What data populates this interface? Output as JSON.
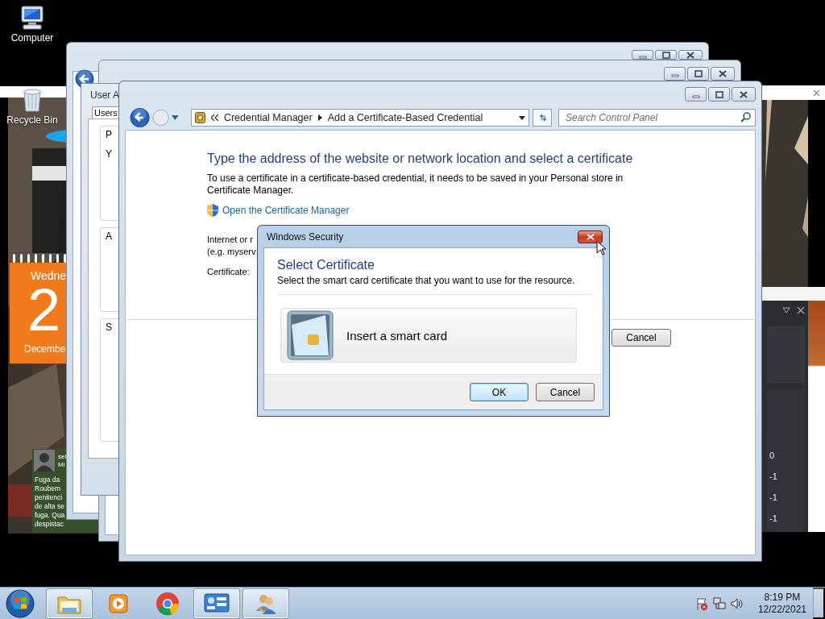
{
  "desktop_icons": [
    {
      "kind": "computer",
      "label": "Computer"
    },
    {
      "kind": "recycle_bin",
      "label": "Recycle Bin"
    }
  ],
  "calendar_gadget": {
    "weekday": "Wedne",
    "day": "2",
    "month": "Decembe"
  },
  "news_gadget": {
    "author": "sel",
    "subtitle": "Mi",
    "lines": [
      "Fuga da",
      "Roubem",
      "penitenci",
      "de alta se",
      "fuga. Qua",
      "despistac"
    ]
  },
  "side_app": {
    "values": [
      "0",
      "-1",
      "-1",
      "-1"
    ]
  },
  "user_accounts_window": {
    "title": "User A",
    "tab": "Users",
    "groups": [
      "P",
      "A",
      "S"
    ],
    "line": "Y"
  },
  "main_window": {
    "breadcrumb": [
      "Credential Manager",
      "Add a Certificate-Based Credential"
    ],
    "search": {
      "placeholder": "Search Control Panel"
    },
    "heading": "Type the address of the website or network location and select a certificate",
    "description": "To use a certificate in a certificate-based credential, it needs to be saved in your Personal store in Certificate Manager.",
    "link": "Open the Certificate Manager",
    "fields": [
      {
        "label": "Internet or r",
        "example": "(e.g. myserv"
      },
      {
        "label": "Certificate:"
      }
    ],
    "buttons": [
      "Cancel"
    ]
  },
  "dialog": {
    "title": "Windows Security",
    "heading": "Select Certificate",
    "description": "Select the smart card certificate that you want to use for the resource.",
    "option": "Insert a smart card",
    "buttons": [
      {
        "label": "OK",
        "default": true
      },
      {
        "label": "Cancel",
        "default": false
      }
    ]
  },
  "taskbar": {
    "apps": [
      {
        "kind": "explorer",
        "active": true
      },
      {
        "kind": "media",
        "active": false
      },
      {
        "kind": "browser",
        "active": false
      },
      {
        "kind": "control_panel",
        "active": true
      },
      {
        "kind": "users",
        "active": true
      }
    ],
    "clock": {
      "time": "8:19 PM",
      "date": "12/22/2021"
    }
  }
}
